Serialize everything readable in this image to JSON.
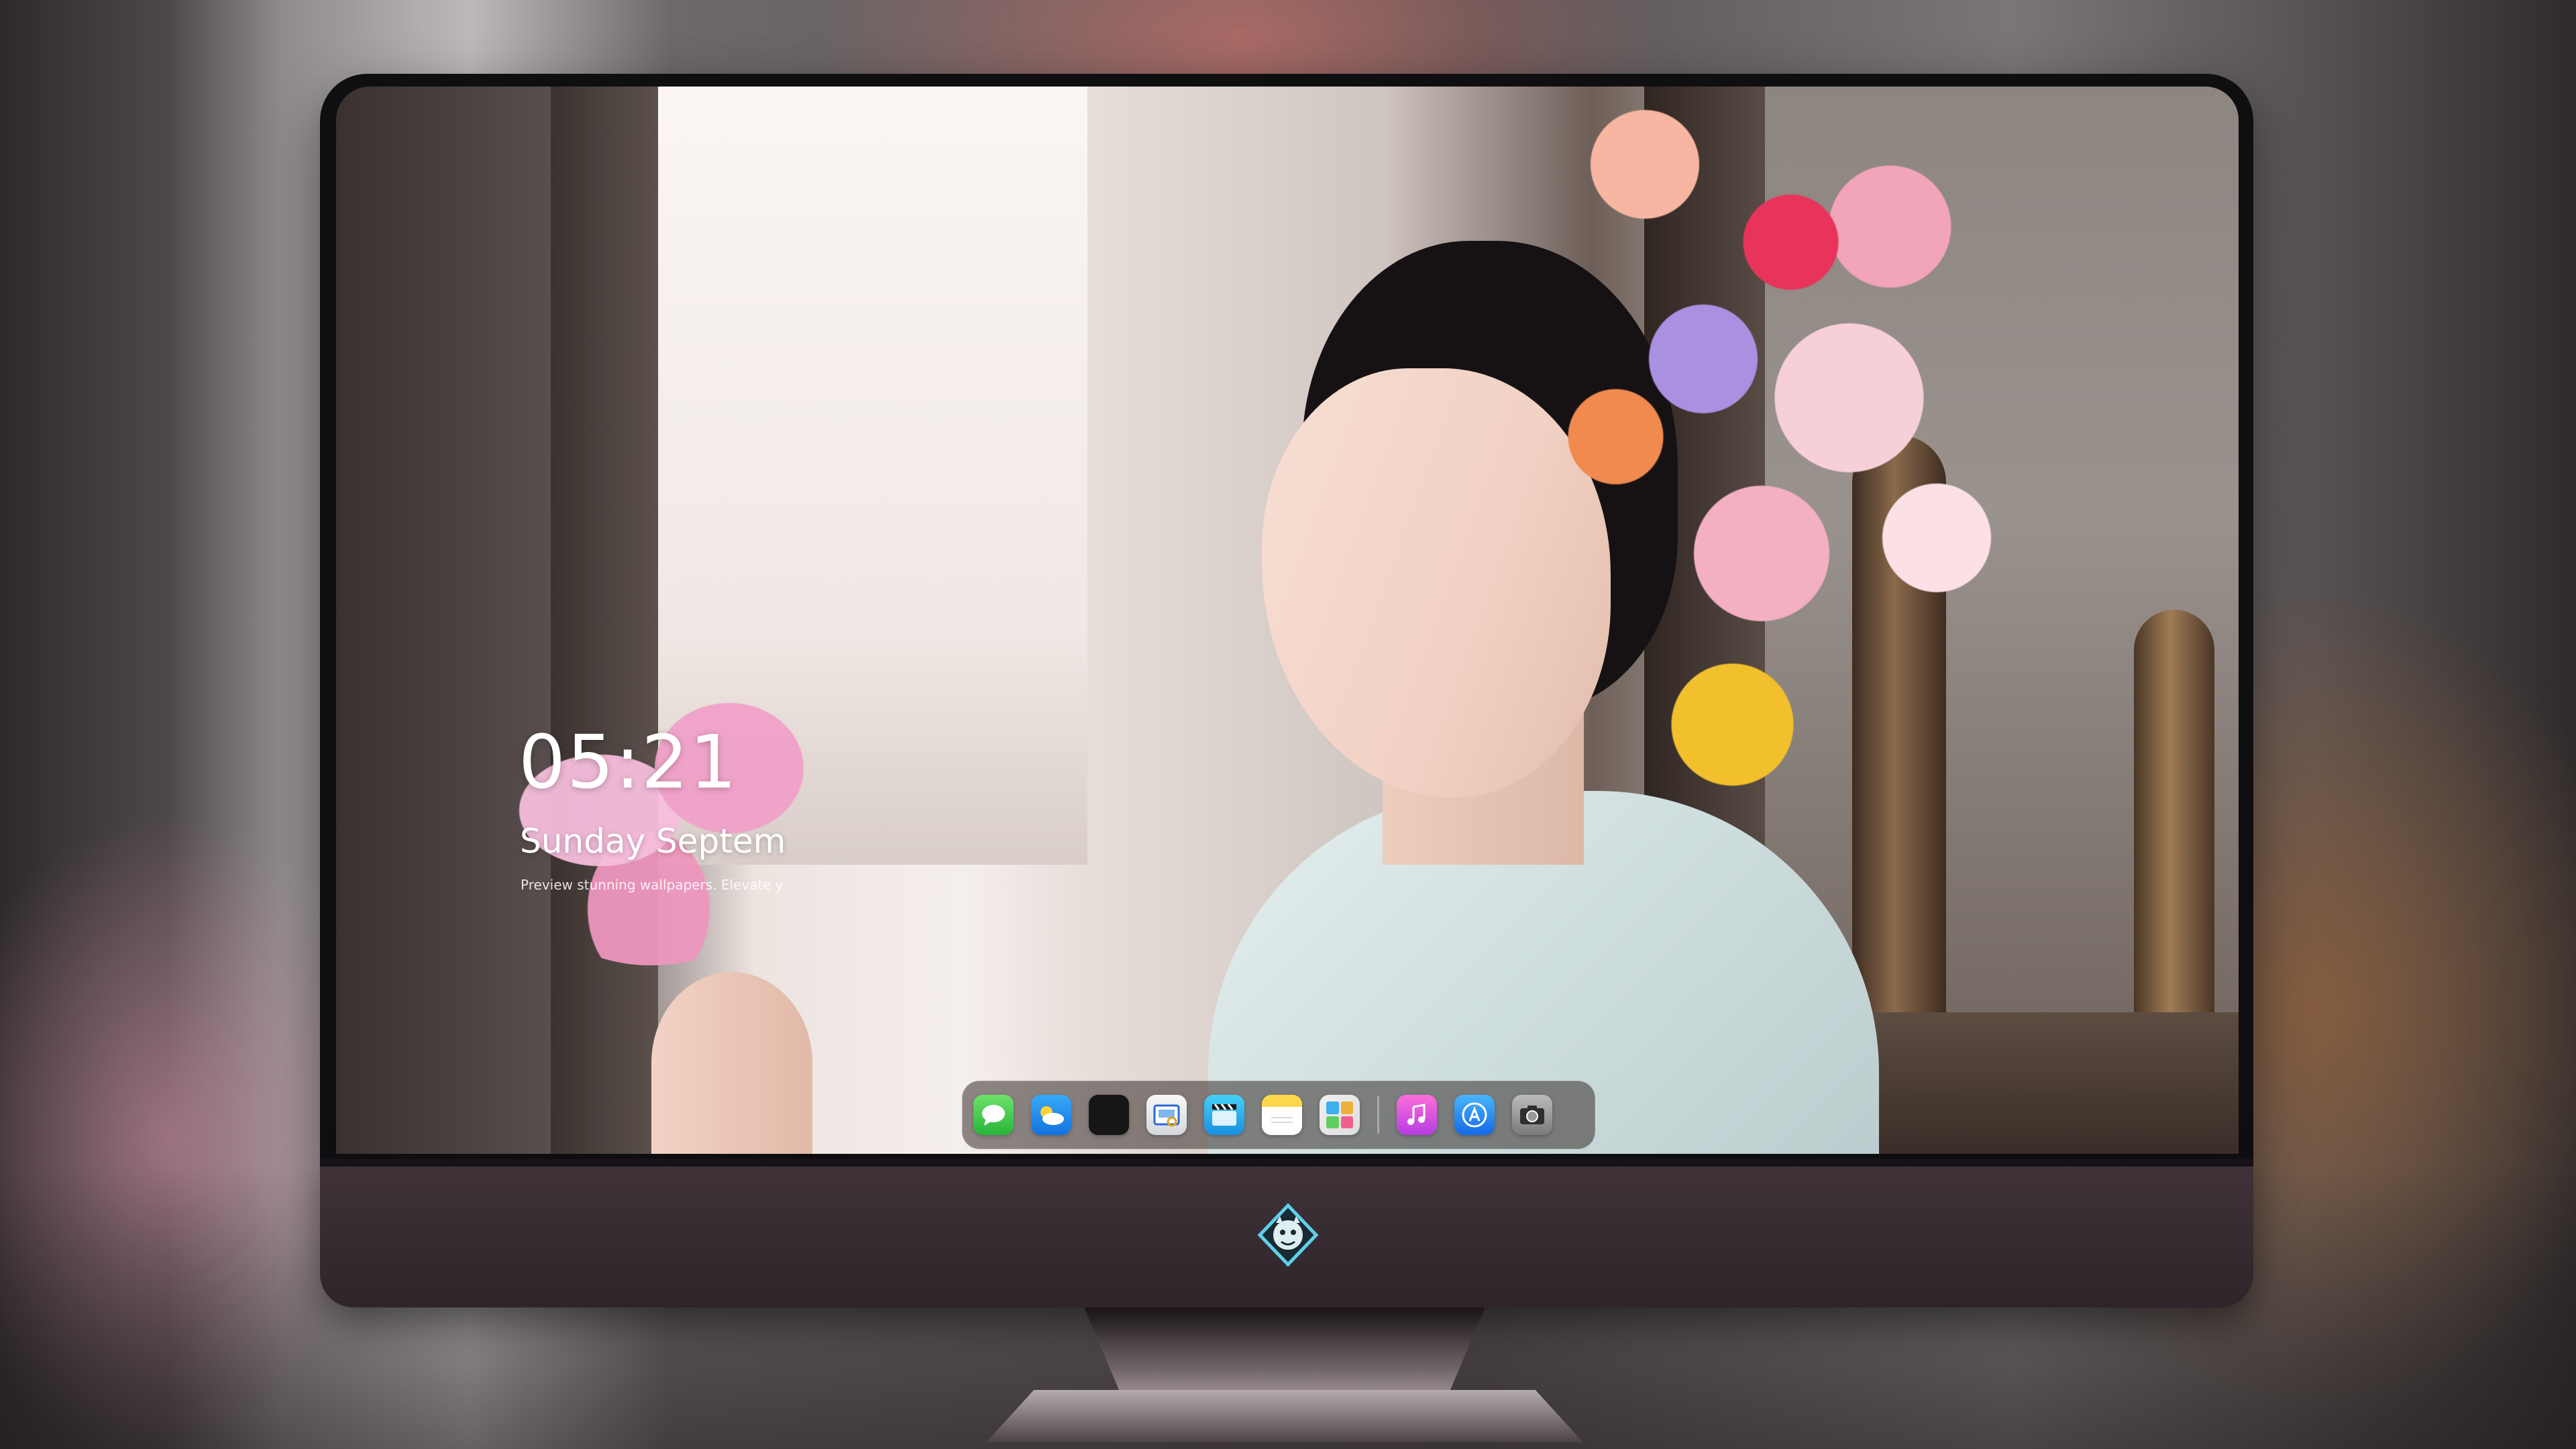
{
  "lock_screen": {
    "time": "05:21",
    "date": "Sunday Septem",
    "caption": "Preview stunning wallpapers. Elevate y"
  },
  "dock": {
    "apps": [
      {
        "name": "Messages",
        "icon": "messages-icon",
        "glyph": "💬",
        "color": "#27b53a"
      },
      {
        "name": "Weather",
        "icon": "weather-icon",
        "glyph": "⛅",
        "color": "#1473e0"
      },
      {
        "name": "Clock",
        "icon": "clock-icon",
        "glyph": "",
        "color": "#161616"
      },
      {
        "name": "Preview",
        "icon": "preview-icon",
        "glyph": "▣",
        "color": "#d5d9dd"
      },
      {
        "name": "Clips",
        "icon": "clips-icon",
        "glyph": "🎬",
        "color": "#1a8fe0"
      },
      {
        "name": "Notes",
        "icon": "notes-icon",
        "glyph": "",
        "color": "#fdd84a"
      },
      {
        "name": "Photos",
        "icon": "photos-icon",
        "glyph": "",
        "color": "#dedede"
      },
      {
        "name": "Music",
        "icon": "music-icon",
        "glyph": "♫",
        "color": "#b63de2"
      },
      {
        "name": "App Store",
        "icon": "app-store-icon",
        "glyph": "Ⓐ",
        "color": "#1669e8"
      },
      {
        "name": "Camera",
        "icon": "camera-icon",
        "glyph": "◉",
        "color": "#7a7a7a"
      }
    ]
  },
  "monitor": {
    "logo_icon": "dragon-mascot-logo-icon",
    "bezel_color": "#0f0f12",
    "chin_color": "#3f3339"
  }
}
